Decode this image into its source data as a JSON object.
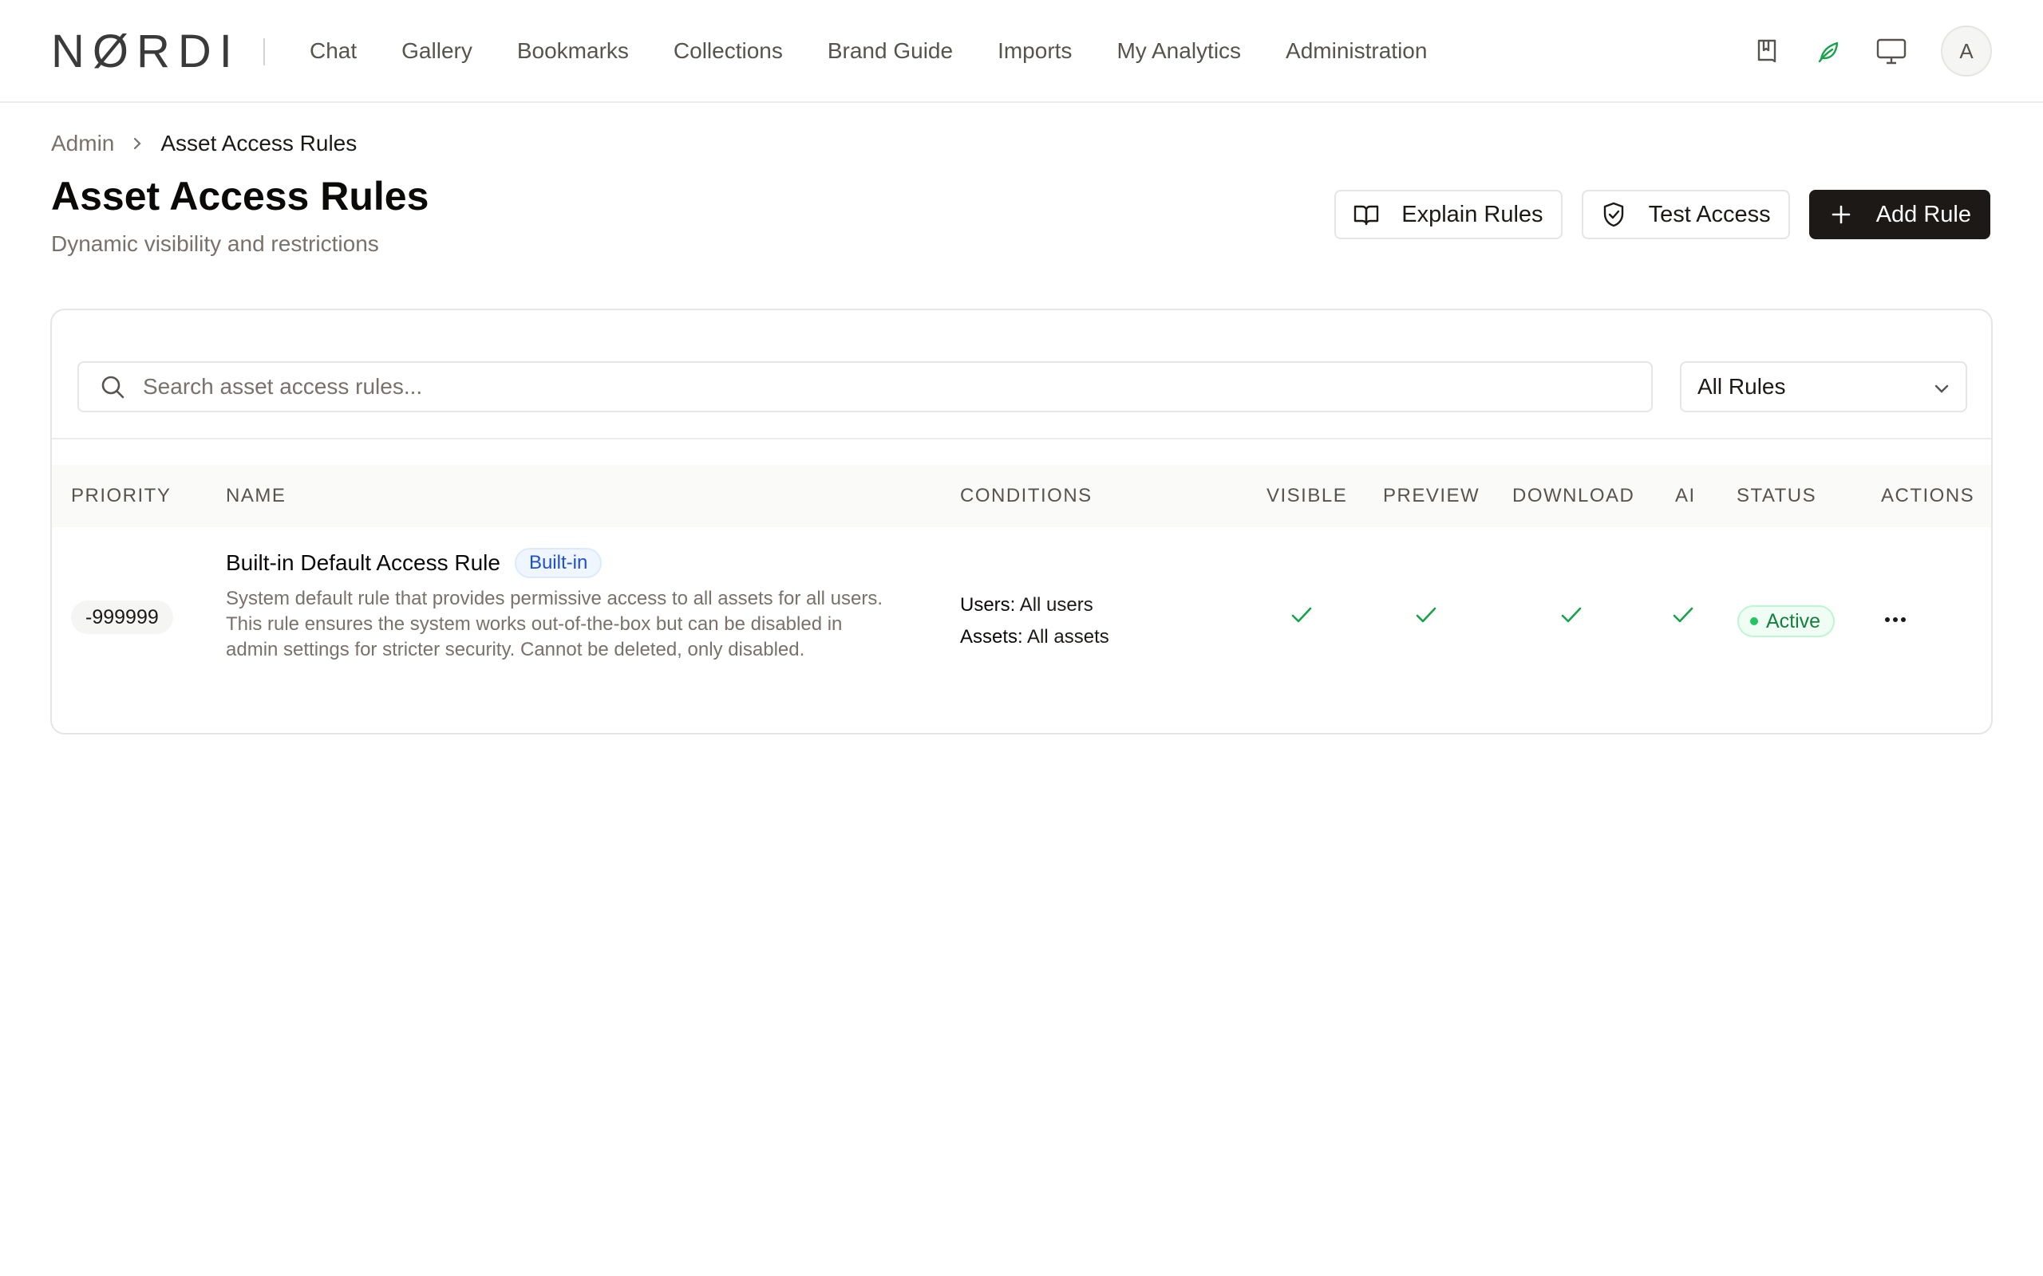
{
  "header": {
    "logo": "NØRDI",
    "nav": [
      {
        "label": "Chat"
      },
      {
        "label": "Gallery"
      },
      {
        "label": "Bookmarks"
      },
      {
        "label": "Collections"
      },
      {
        "label": "Brand Guide"
      },
      {
        "label": "Imports"
      },
      {
        "label": "My Analytics"
      },
      {
        "label": "Administration"
      }
    ],
    "icons": [
      "bookmark-icon",
      "leaf-icon",
      "monitor-icon"
    ],
    "avatar_initial": "A",
    "accent_color": "#16a34a"
  },
  "breadcrumb": {
    "parent": "Admin",
    "current": "Asset Access Rules"
  },
  "page": {
    "title": "Asset Access Rules",
    "subtitle": "Dynamic visibility and restrictions"
  },
  "actions": {
    "explain": "Explain Rules",
    "test": "Test Access",
    "add": "Add Rule"
  },
  "filters": {
    "search_placeholder": "Search asset access rules...",
    "search_value": "",
    "select_value": "All Rules"
  },
  "table": {
    "columns": {
      "priority": "PRIORITY",
      "name": "NAME",
      "conditions": "CONDITIONS",
      "visible": "VISIBLE",
      "preview": "PREVIEW",
      "download": "DOWNLOAD",
      "ai": "AI",
      "status": "STATUS",
      "actions": "ACTIONS"
    },
    "rows": [
      {
        "priority": "-999999",
        "name": "Built-in Default Access Rule",
        "badge": "Built-in",
        "description": "System default rule that provides permissive access to all assets for all users. This rule ensures the system works out-of-the-box but can be disabled in admin settings for stricter security. Cannot be deleted, only disabled.",
        "conditions": {
          "users_label": "Users:",
          "users_value": "All users",
          "assets_label": "Assets:",
          "assets_value": "All assets"
        },
        "visible": true,
        "preview": true,
        "download": true,
        "ai": true,
        "status": "Active",
        "status_color": "#15803d"
      }
    ]
  }
}
